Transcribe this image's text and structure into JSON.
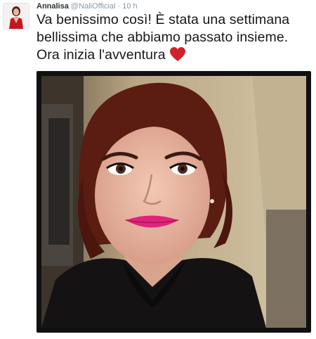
{
  "tweet": {
    "author_name": "Annalisa",
    "author_handle": "@NaliOfficial",
    "separator": "·",
    "timestamp": "10 h",
    "text": "Va benissimo così! È stata una settimana bellissima che abbiamo passato insieme. Ora inizia l'avventura",
    "emoji": "red-heart-icon"
  },
  "colors": {
    "heart": "#d0202a",
    "name": "#292f33",
    "muted": "#8899a6",
    "text": "#14171a",
    "media_frame": "#101010"
  }
}
